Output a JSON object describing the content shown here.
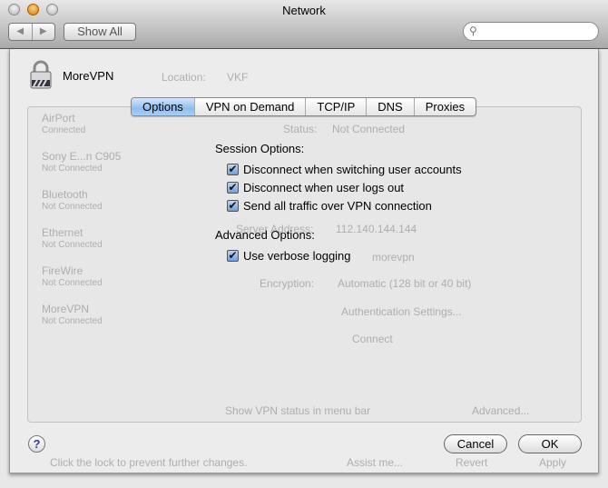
{
  "window": {
    "title": "Network",
    "show_all": "Show All",
    "back": "◀",
    "forward": "▶",
    "search_placeholder": ""
  },
  "background": {
    "location_label": "Location:",
    "location_value": "VKF",
    "services": [
      {
        "name": "AirPort",
        "status": "Connected"
      },
      {
        "name": "Sony E...n C905",
        "status": "Not Connected"
      },
      {
        "name": "Bluetooth",
        "status": "Not Connected"
      },
      {
        "name": "Ethernet",
        "status": "Not Connected"
      },
      {
        "name": "FireWire",
        "status": "Not Connected"
      },
      {
        "name": "MoreVPN",
        "status": "Not Connected"
      }
    ],
    "status_label": "Status:",
    "status_value": "Not Connected",
    "server_label": "Server Address:",
    "server_value": "112.140.144.144",
    "account_value": "morevpn",
    "encryption_label": "Encryption:",
    "encryption_value": "Automatic (128 bit or 40 bit)",
    "auth_button": "Authentication Settings...",
    "connect_button": "Connect",
    "show_status": "Show VPN status in menu bar",
    "advanced_button": "Advanced...",
    "lock_text": "Click the lock to prevent further changes.",
    "assist_button": "Assist me...",
    "revert_button": "Revert",
    "apply_button": "Apply"
  },
  "sheet": {
    "service_name": "MoreVPN",
    "tabs": [
      {
        "label": "Options",
        "active": true
      },
      {
        "label": "VPN on Demand"
      },
      {
        "label": "TCP/IP"
      },
      {
        "label": "DNS"
      },
      {
        "label": "Proxies"
      }
    ],
    "session_title": "Session Options:",
    "session_options": [
      {
        "label": "Disconnect when switching user accounts",
        "checked": true
      },
      {
        "label": "Disconnect when user logs out",
        "checked": true
      },
      {
        "label": "Send all traffic over VPN connection",
        "checked": true
      }
    ],
    "advanced_title": "Advanced Options:",
    "advanced_options": [
      {
        "label": "Use verbose logging",
        "checked": true
      }
    ],
    "help": "?",
    "cancel": "Cancel",
    "ok": "OK",
    "check": "✔"
  }
}
